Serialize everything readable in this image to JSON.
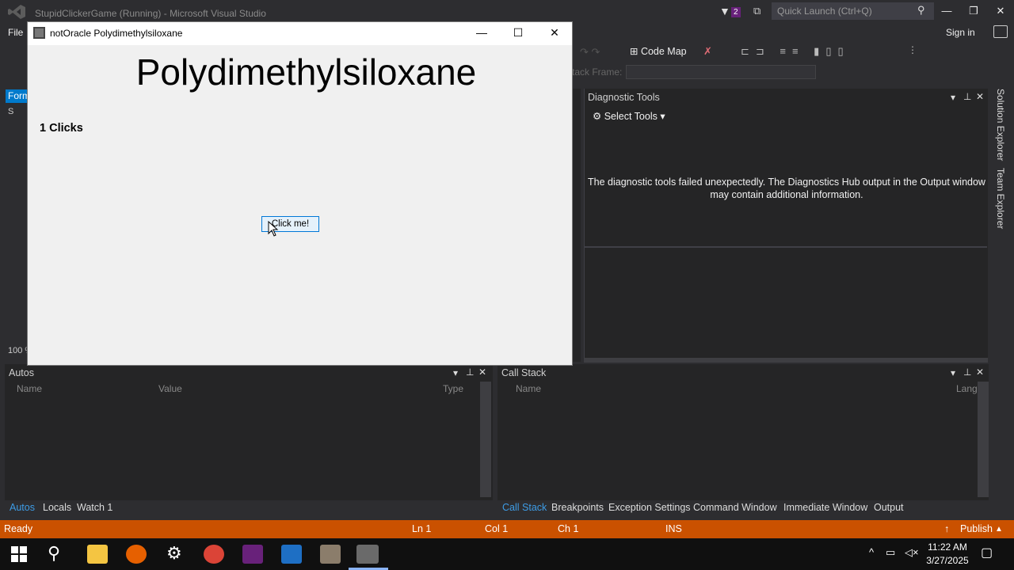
{
  "vs": {
    "title": "StupidClickerGame (Running) - Microsoft Visual Studio",
    "notification_count": "2",
    "quick_launch_placeholder": "Quick Launch (Ctrl+Q)",
    "menu_file": "File",
    "sign_in": "Sign in",
    "toolbar_code_map": "Code Map",
    "stack_frame_label": "tack Frame:",
    "left_tab_stub": "Form",
    "left_tab_stub2": "S",
    "zoom": "100 %"
  },
  "diagnostic": {
    "title": "Diagnostic Tools",
    "select_tools": "Select Tools",
    "message": "The diagnostic tools failed unexpectedly. The Diagnostics Hub output in the Output window may contain additional information."
  },
  "side_tabs": [
    "Solution Explorer",
    "Team Explorer"
  ],
  "autos": {
    "title": "Autos",
    "columns": [
      "Name",
      "Value",
      "Type"
    ],
    "tabs": [
      "Autos",
      "Locals",
      "Watch 1"
    ]
  },
  "callstack": {
    "title": "Call Stack",
    "columns": [
      "Name",
      "Lang"
    ],
    "tabs": [
      "Call Stack",
      "Breakpoints",
      "Exception Settings",
      "Command Window",
      "Immediate Window",
      "Output"
    ]
  },
  "status": {
    "ready": "Ready",
    "ln": "Ln 1",
    "col": "Col 1",
    "ch": "Ch 1",
    "ins": "INS",
    "publish": "Publish"
  },
  "app": {
    "title": "notOracle Polydimethylsiloxane",
    "heading": "Polydimethylsiloxane",
    "clicks": "1 Clicks",
    "button": "Click me!"
  },
  "taskbar": {
    "time": "11:22 AM",
    "date": "3/27/2025",
    "icons": [
      "windows-start-icon",
      "search-icon",
      "file-explorer-icon",
      "firefox-icon",
      "settings-icon",
      "chrome-icon",
      "visual-studio-icon",
      "vscode-icon",
      "gimp-icon",
      "app-icon"
    ]
  },
  "colors": {
    "vs_bg": "#2d2d30",
    "status_bar": "#ca5100",
    "accent": "#007acc",
    "button_border": "#0078d7"
  }
}
